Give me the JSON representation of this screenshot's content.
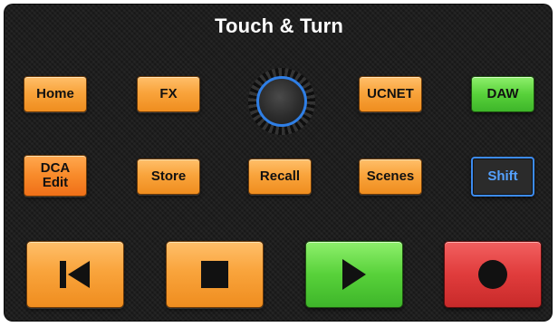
{
  "title": "Touch & Turn",
  "buttons": {
    "home": "Home",
    "fx": "FX",
    "ucnet": "UCNET",
    "daw": "DAW",
    "dca_edit_line1": "DCA",
    "dca_edit_line2": "Edit",
    "store": "Store",
    "recall": "Recall",
    "scenes": "Scenes",
    "shift": "Shift"
  },
  "transport": {
    "previous_icon": "skip-previous-icon",
    "stop_icon": "stop-icon",
    "play_icon": "play-icon",
    "record_icon": "record-icon"
  },
  "encoder": {
    "icon": "rotary-knob"
  },
  "colors": {
    "panel": "#1c1c1c",
    "orange": "#f9a43c",
    "green": "#58d13a",
    "red": "#e03c3c",
    "shift_border": "#3c8bf0"
  }
}
